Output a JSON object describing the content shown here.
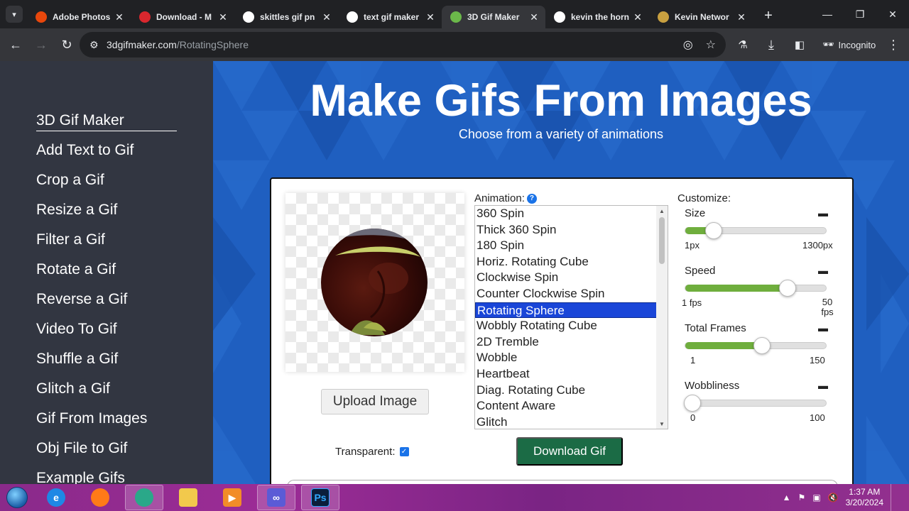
{
  "browser": {
    "tabs": [
      {
        "title": "Adobe Photos",
        "favicon": "adobe-icon",
        "color": "#e8470c"
      },
      {
        "title": "Download - M",
        "favicon": "mega-icon",
        "color": "#d9272e"
      },
      {
        "title": "skittles gif pn",
        "favicon": "google-icon",
        "color": "#ffffff"
      },
      {
        "title": "text gif maker",
        "favicon": "google-icon",
        "color": "#ffffff"
      },
      {
        "title": "3D Gif Maker",
        "favicon": "3dgifmaker-icon",
        "color": "#6bb84a",
        "active": true
      },
      {
        "title": "kevin the horn",
        "favicon": "google-icon",
        "color": "#ffffff"
      },
      {
        "title": "Kevin Networ",
        "favicon": "kevin-icon",
        "color": "#c8a040"
      }
    ],
    "url_host": "3dgifmaker.com",
    "url_path": "/RotatingSphere",
    "incognito_label": "Incognito"
  },
  "sidebar": {
    "items": [
      "3D Gif Maker",
      "Add Text to Gif",
      "Crop a Gif",
      "Resize a Gif",
      "Filter a Gif",
      "Rotate a Gif",
      "Reverse a Gif",
      "Video To Gif",
      "Shuffle a Gif",
      "Glitch a Gif",
      "Gif From Images",
      "Obj File to Gif",
      "Example Gifs"
    ]
  },
  "hero": {
    "title": "Make Gifs From Images",
    "subtitle": "Choose from a variety of animations"
  },
  "editor": {
    "upload_label": "Upload Image",
    "transparent_label": "Transparent:",
    "transparent_checked": true,
    "animation_label": "Animation:",
    "animations": [
      "360 Spin",
      "Thick 360 Spin",
      "180 Spin",
      "Horiz. Rotating Cube",
      "Clockwise Spin",
      "Counter Clockwise Spin",
      "Rotating Sphere",
      "Wobbly Rotating Cube",
      "2D Tremble",
      "Wobble",
      "Heartbeat",
      "Diag. Rotating Cube",
      "Content Aware",
      "Glitch"
    ],
    "selected_animation": "Rotating Sphere",
    "download_label": "Download Gif",
    "customize_label": "Customize:",
    "controls": [
      {
        "name": "Size",
        "min_label": "1px",
        "max_label": "1300px",
        "fraction": 0.2
      },
      {
        "name": "Speed",
        "min_label": "1 fps",
        "max_label": "50 fps",
        "fraction": 0.72
      },
      {
        "name": "Total Frames",
        "min_label": "1",
        "max_label": "150",
        "fraction": 0.54
      },
      {
        "name": "Wobbliness",
        "min_label": "0",
        "max_label": "100",
        "fraction": 0.05
      }
    ]
  },
  "taskbar": {
    "apps": [
      "internet-explorer-icon",
      "firefox-icon",
      "chrome-icon",
      "file-explorer-icon",
      "media-player-icon",
      "infinity-app-icon",
      "photoshop-icon"
    ],
    "time": "1:37 AM",
    "date": "3/20/2024"
  },
  "colors": {
    "accent_green": "#6fae3d",
    "download_green": "#1b6b45",
    "selection_blue": "#1a46d8",
    "hero_blue": "#1f5fc0",
    "sidebar_bg": "#323641"
  }
}
